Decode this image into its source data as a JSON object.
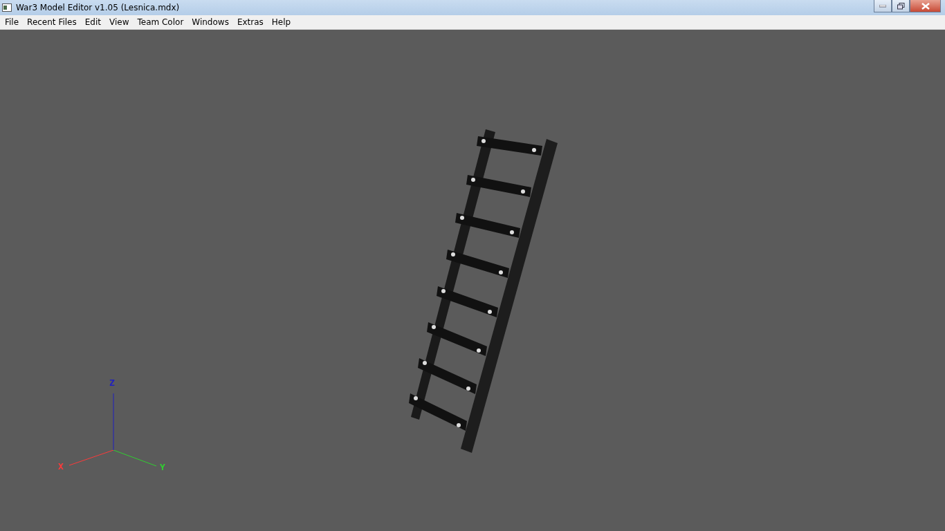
{
  "window": {
    "title": "War3 Model Editor v1.05 (Lesnica.mdx)"
  },
  "menu": [
    "File",
    "Recent Files",
    "Edit",
    "View",
    "Team Color",
    "Windows",
    "Extras",
    "Help"
  ],
  "axes": [
    {
      "label": "X",
      "color": "#ff3a3a"
    },
    {
      "label": "Y",
      "color": "#30d030"
    },
    {
      "label": "Z",
      "color": "#2020c0"
    }
  ]
}
